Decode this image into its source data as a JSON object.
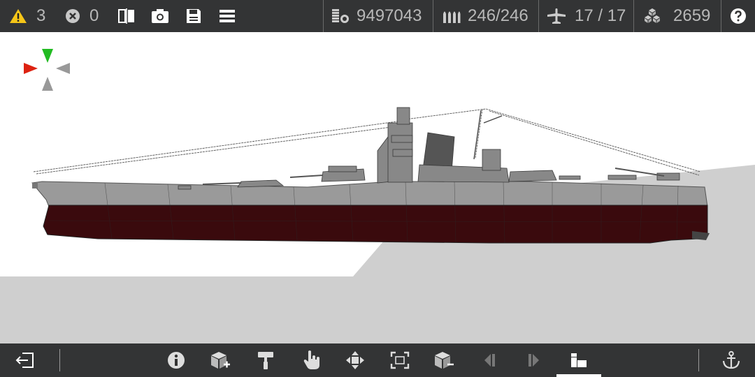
{
  "top_bar": {
    "warnings_count": "3",
    "errors_count": "0",
    "cost": "9497043",
    "ammo": "246/246",
    "aircraft": "17 / 17",
    "weight": "2659"
  },
  "icons": {
    "warning": "warning-icon",
    "error": "error-icon",
    "symmetry": "symmetry-icon",
    "camera": "camera-icon",
    "save": "save-icon",
    "menu": "menu-icon",
    "cost": "coins-icon",
    "ammo": "ammo-icon",
    "aircraft": "aircraft-icon",
    "weight": "weight-icon",
    "help": "help-icon"
  },
  "bottom_bar": {
    "tools": [
      "exit",
      "info",
      "add-part",
      "paint",
      "select",
      "move",
      "resize",
      "remove-part",
      "previous",
      "next",
      "camera-view",
      "anchor"
    ],
    "active_tool": "camera-view"
  },
  "colors": {
    "toolbar_bg": "#333435",
    "warning": "#f5c518",
    "hull_upper": "#9a9a9a",
    "hull_lower": "#3a0a0d",
    "ground": "#cfcfcf",
    "axis_up": "#22bb22",
    "axis_left": "#dd2211"
  }
}
